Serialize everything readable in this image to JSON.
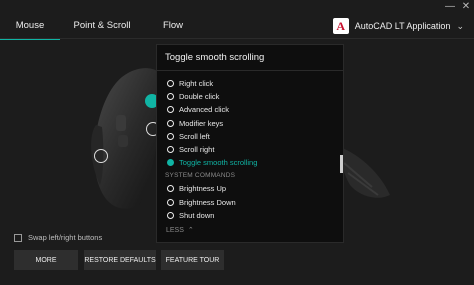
{
  "window": {
    "minimize": "—",
    "close": "✕"
  },
  "tabs": [
    {
      "label": "Mouse"
    },
    {
      "label": "Point & Scroll"
    },
    {
      "label": "Flow"
    }
  ],
  "app": {
    "name": "AutoCAD LT Application",
    "logo_letter": "A",
    "logo_color": "#c8102e"
  },
  "panel": {
    "title": "Toggle smooth scrolling",
    "options": [
      {
        "label": "Right click"
      },
      {
        "label": "Double click"
      },
      {
        "label": "Advanced click"
      },
      {
        "label": "Modifier keys"
      },
      {
        "label": "Scroll left"
      },
      {
        "label": "Scroll right"
      },
      {
        "label": "Toggle smooth scrolling"
      }
    ],
    "section_label": "SYSTEM COMMANDS",
    "system_options": [
      {
        "label": "Brightness Up"
      },
      {
        "label": "Brightness Down"
      },
      {
        "label": "Shut down"
      }
    ],
    "less_label": "LESS"
  },
  "swap_label": "Swap left/right buttons",
  "buttons": {
    "more": "MORE",
    "restore": "RESTORE DEFAULTS",
    "tour": "FEATURE TOUR"
  },
  "colors": {
    "accent": "#10b4a4",
    "background": "#1c1c1c"
  }
}
